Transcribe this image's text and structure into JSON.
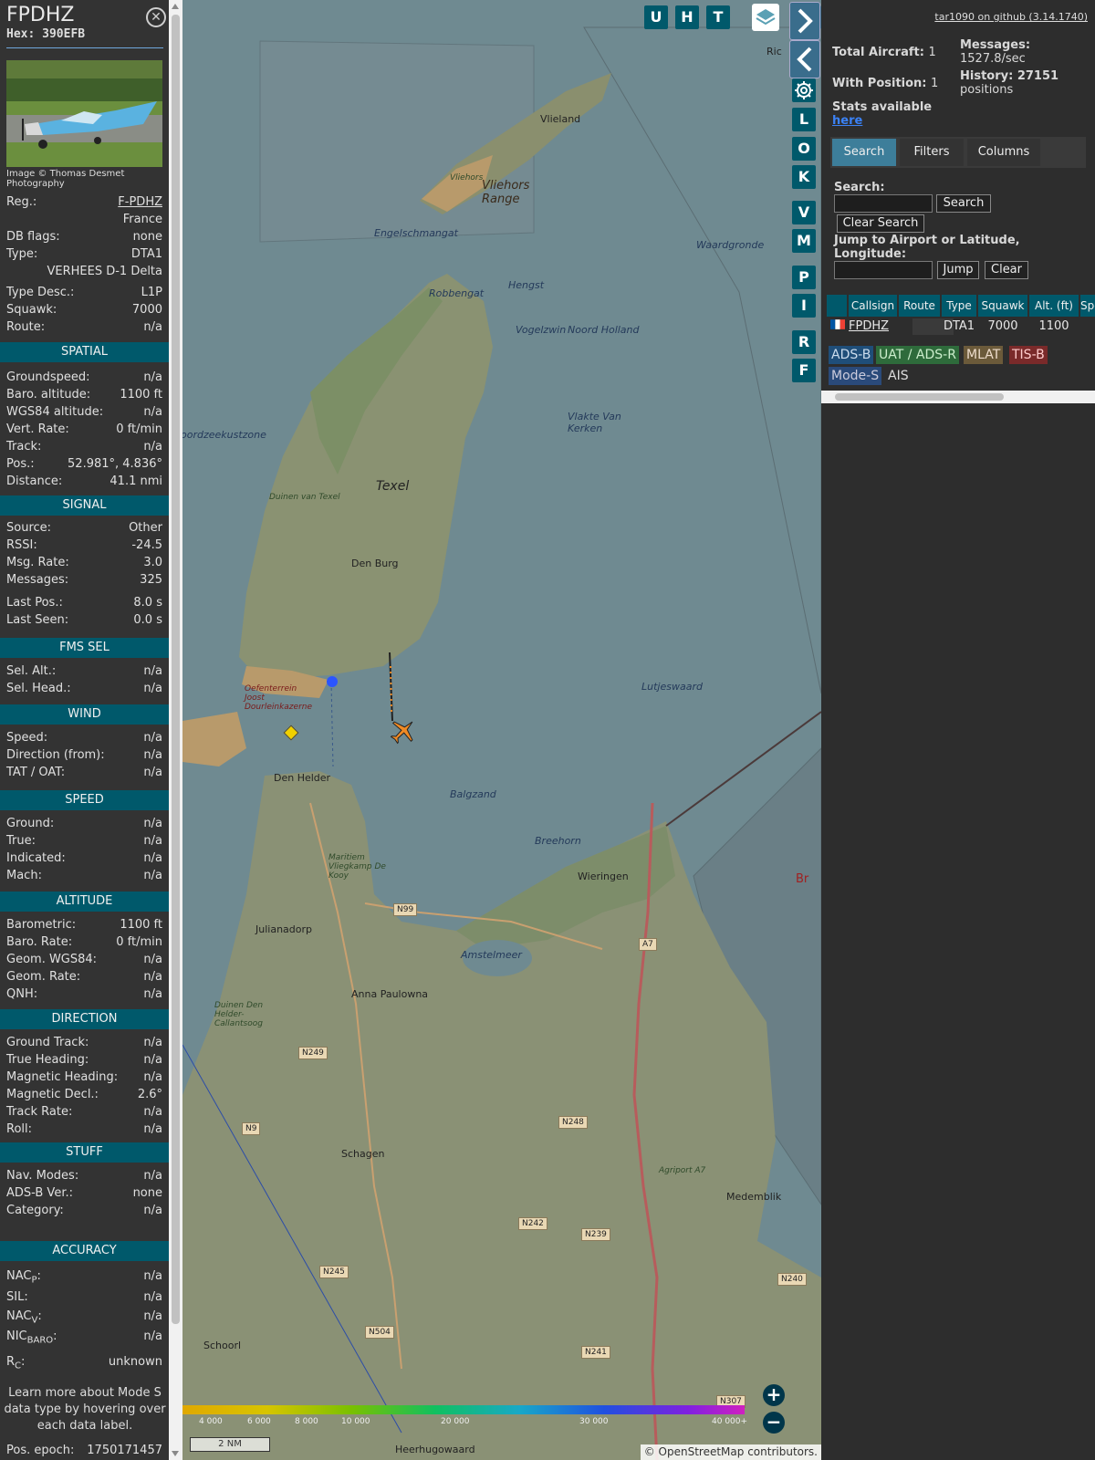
{
  "aircraft": {
    "callsign": "FPDHZ",
    "hex": "Hex: 390EFB",
    "image_credit": "Image © Thomas Desmet Photography",
    "reg_label": "Reg.:",
    "reg": "F-PDHZ",
    "country": "France",
    "dbflags_label": "DB flags:",
    "dbflags": "none",
    "type_label": "Type:",
    "type": "DTA1",
    "type_full": "VERHEES D-1 Delta",
    "typedesc_label": "Type Desc.:",
    "typedesc": "L1P",
    "squawk_label": "Squawk:",
    "squawk": "7000",
    "route_label": "Route:",
    "route": "n/a"
  },
  "sections": {
    "spatial": "SPATIAL",
    "signal": "SIGNAL",
    "fms": "FMS SEL",
    "wind": "WIND",
    "speed": "SPEED",
    "altitude": "ALTITUDE",
    "direction": "DIRECTION",
    "stuff": "STUFF",
    "accuracy": "ACCURACY"
  },
  "spatial": [
    {
      "k": "Groundspeed:",
      "v": "n/a"
    },
    {
      "k": "Baro. altitude:",
      "v": "1100 ft"
    },
    {
      "k": "WGS84 altitude:",
      "v": "n/a"
    },
    {
      "k": "Vert. Rate:",
      "v": "0 ft/min"
    },
    {
      "k": "Track:",
      "v": "n/a"
    },
    {
      "k": "Pos.:",
      "v": "52.981°, 4.836°"
    },
    {
      "k": "Distance:",
      "v": "41.1 nmi"
    }
  ],
  "signal": [
    {
      "k": "Source:",
      "v": "Other"
    },
    {
      "k": "RSSI:",
      "v": "-24.5"
    },
    {
      "k": "Msg. Rate:",
      "v": "3.0"
    },
    {
      "k": "Messages:",
      "v": "325"
    },
    {
      "k": "Last Pos.:",
      "v": "8.0 s"
    },
    {
      "k": "Last Seen:",
      "v": "0.0 s"
    }
  ],
  "fms": [
    {
      "k": "Sel. Alt.:",
      "v": "n/a"
    },
    {
      "k": "Sel. Head.:",
      "v": "n/a"
    }
  ],
  "wind": [
    {
      "k": "Speed:",
      "v": "n/a"
    },
    {
      "k": "Direction (from):",
      "v": "n/a"
    },
    {
      "k": "TAT / OAT:",
      "v": "n/a"
    }
  ],
  "speed": [
    {
      "k": "Ground:",
      "v": "n/a"
    },
    {
      "k": "True:",
      "v": "n/a"
    },
    {
      "k": "Indicated:",
      "v": "n/a"
    },
    {
      "k": "Mach:",
      "v": "n/a"
    }
  ],
  "altitude": [
    {
      "k": "Barometric:",
      "v": "1100 ft"
    },
    {
      "k": "Baro. Rate:",
      "v": "0 ft/min"
    },
    {
      "k": "Geom. WGS84:",
      "v": "n/a"
    },
    {
      "k": "Geom. Rate:",
      "v": "n/a"
    },
    {
      "k": "QNH:",
      "v": "n/a"
    }
  ],
  "direction": [
    {
      "k": "Ground Track:",
      "v": "n/a"
    },
    {
      "k": "True Heading:",
      "v": "n/a"
    },
    {
      "k": "Magnetic Heading:",
      "v": "n/a"
    },
    {
      "k": "Magnetic Decl.:",
      "v": "2.6°"
    },
    {
      "k": "Track Rate:",
      "v": "n/a"
    },
    {
      "k": "Roll:",
      "v": "n/a"
    }
  ],
  "stuff": [
    {
      "k": "Nav. Modes:",
      "v": "n/a"
    },
    {
      "k": "ADS-B Ver.:",
      "v": "none"
    },
    {
      "k": "Category:",
      "v": "n/a"
    }
  ],
  "accuracy": {
    "nacp_main": "NAC",
    "nacp_sub": "P",
    "nacp_v": "n/a",
    "sil_k": "SIL:",
    "sil_v": "n/a",
    "nacv_main": "NAC",
    "nacv_sub": "V",
    "nacv_v": "n/a",
    "nic_main": "NIC",
    "nic_sub": "BARO",
    "nic_v": "n/a",
    "rc_main": "R",
    "rc_sub": "C",
    "rc_v": "unknown",
    "colon": ":"
  },
  "learn_more": "Learn more about Mode S data type by hovering over each data label.",
  "pos_epoch_label": "Pos. epoch:",
  "pos_epoch": "1750171457",
  "map": {
    "buttons": [
      "U",
      "H",
      "T",
      "L",
      "O",
      "K",
      "V",
      "M",
      "P",
      "I",
      "R",
      "F"
    ],
    "places": [
      {
        "name": "Vlieland",
        "cls": "town"
      },
      {
        "name": "Vliehors Range",
        "cls": "area"
      },
      {
        "name": "Texel",
        "cls": "big"
      },
      {
        "name": "Den Burg",
        "cls": "town"
      },
      {
        "name": "Den Helder",
        "cls": "town"
      },
      {
        "name": "Wieringen",
        "cls": "town"
      },
      {
        "name": "Julianadorp",
        "cls": "town"
      },
      {
        "name": "Anna Paulowna",
        "cls": "town"
      },
      {
        "name": "Schagen",
        "cls": "town"
      },
      {
        "name": "Medemblik",
        "cls": "town"
      },
      {
        "name": "Schoorl",
        "cls": "town"
      },
      {
        "name": "Heerhugowaard",
        "cls": "town"
      },
      {
        "name": "Waardgronde",
        "cls": "water"
      },
      {
        "name": "oordzeekustzone",
        "cls": "water"
      },
      {
        "name": "Lutjeswaard",
        "cls": "water"
      },
      {
        "name": "Vlakte Van Kerken",
        "cls": "water"
      },
      {
        "name": "Balgzand",
        "cls": "water"
      },
      {
        "name": "Breehorn",
        "cls": "water"
      },
      {
        "name": "Duinen van Texel",
        "cls": "park"
      },
      {
        "name": "Oefenterrein Joost Dourleinkazerne",
        "cls": "mil"
      },
      {
        "name": "Maritiem Vliegkamp De Kooy",
        "cls": "park"
      },
      {
        "name": "Duinen Den Helder-Callantsoog",
        "cls": "park"
      },
      {
        "name": "Amstelmeer",
        "cls": "water"
      },
      {
        "name": "Agriport A7",
        "cls": "park"
      },
      {
        "name": "Engelschmangat",
        "cls": "water"
      },
      {
        "name": "Vliehors",
        "cls": "park"
      },
      {
        "name": "Hengst",
        "cls": "water"
      },
      {
        "name": "Robbengat",
        "cls": "water"
      },
      {
        "name": "Vogelzwin",
        "cls": "water"
      },
      {
        "name": "Noord Holland",
        "cls": "water"
      },
      {
        "name": "Ric",
        "cls": "town"
      },
      {
        "name": "Br",
        "cls": "red"
      }
    ],
    "roads": [
      "N99",
      "A7",
      "N249",
      "N9",
      "N248",
      "N242",
      "N239",
      "N245",
      "N504",
      "N241",
      "N240",
      "N307"
    ],
    "colorbar_labels": [
      "4 000",
      "6 000",
      "8 000",
      "10 000",
      "20 000",
      "30 000",
      "40 000+"
    ],
    "scale": "2 NM",
    "zoom_in": "+",
    "zoom_out": "−",
    "attribution_prefix": "©",
    "attribution_link": "OpenStreetMap",
    "attribution_suffix": "contributors."
  },
  "right": {
    "github": "tar1090 on github (3.14.1740)",
    "total_label": "Total Aircraft:",
    "total": "1",
    "withpos_label": "With Position:",
    "withpos": "1",
    "messages_label": "Messages:",
    "messages": "1527.8/sec",
    "history_label": "History: 27151",
    "history2": "positions",
    "stats_label": "Stats available",
    "stats_link": "here",
    "tabs": [
      "Search",
      "Filters",
      "Columns"
    ],
    "search_label": "Search:",
    "search_btn": "Search",
    "clear_search_btn": "Clear Search",
    "jump_label": "Jump to Airport or Latitude, Longitude:",
    "jump_btn": "Jump",
    "clear_btn": "Clear",
    "columns": [
      "Callsign",
      "Route",
      "Type",
      "Squawk",
      "Alt. (ft)",
      "Spd."
    ],
    "row": {
      "callsign": "FPDHZ",
      "route": "",
      "type": "DTA1",
      "squawk": "7000",
      "alt": "1100"
    },
    "tags": [
      "ADS-B",
      "UAT / ADS-R",
      "MLAT",
      "TIS-B",
      "Mode-S",
      "AIS"
    ]
  },
  "colors": {
    "section_bg": "#00596b",
    "aircraft": "#f08a24",
    "receiver": "#2b55ff",
    "tag_adsb": "#1f4e79",
    "tag_uat": "#2e6b3b",
    "tag_mlat": "#6b5a3a",
    "tag_tisb": "#7a2a2a",
    "tag_modes": "#2a4a7a"
  }
}
